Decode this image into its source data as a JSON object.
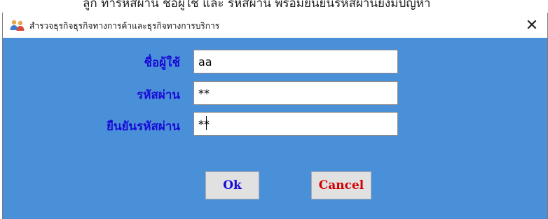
{
  "background_text": "ลูก ทำรหัสผ่าน ชื่อผู้ใช้ และ รหัสผ่าน พร้อมยืนยันรหัสผ่านยังมีปัญหา",
  "window": {
    "title": "สำรวจธุรกิจธุรกิจทางการค้าและธุรกิจทางการบริการ",
    "close_symbol": "✕"
  },
  "form": {
    "username_label": "ชื่อผู้ใช้",
    "username_value": "aa",
    "password_label": "รหัสผ่าน",
    "password_value": "**",
    "confirm_label": "ยืนยันรหัสผ่าน",
    "confirm_value": "**"
  },
  "buttons": {
    "ok": "Ok",
    "cancel": "Cancel"
  },
  "colors": {
    "client_background": "#4a90d9",
    "label_color": "#1a0ad6",
    "ok_text": "#1a0ad6",
    "cancel_text": "#d20000"
  },
  "icons": {
    "app": "users-icon",
    "close": "close-icon"
  }
}
